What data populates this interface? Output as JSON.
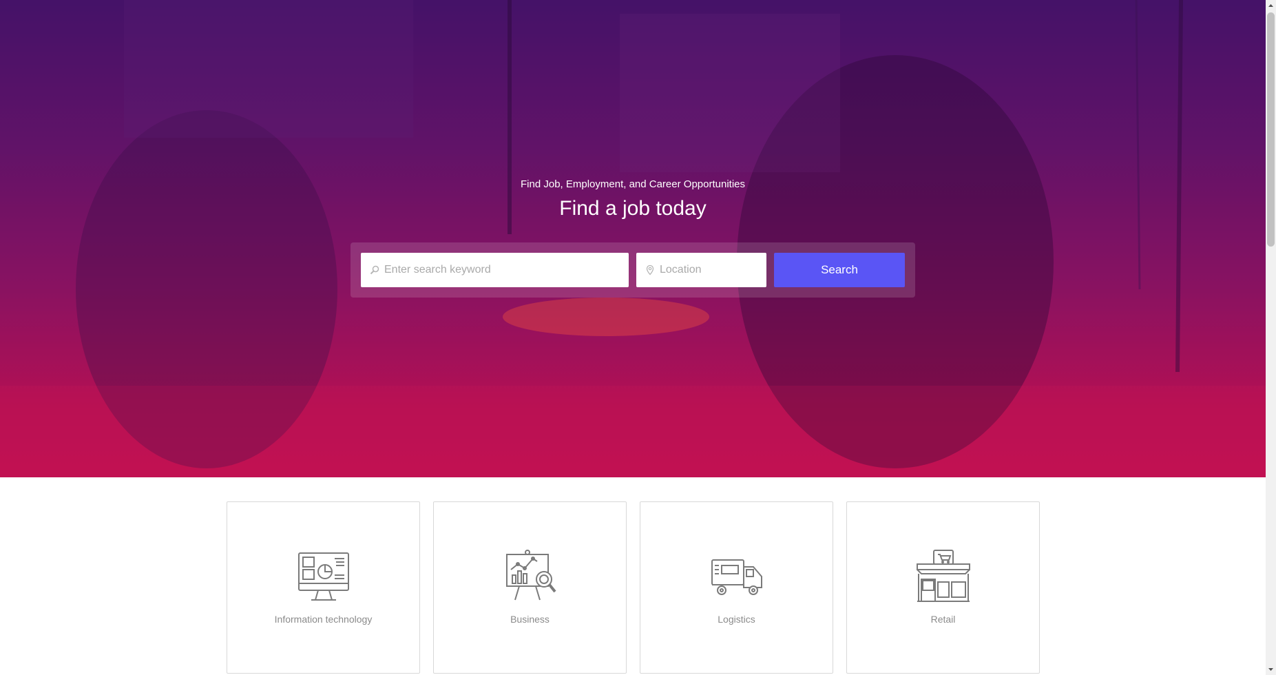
{
  "hero": {
    "subtitle": "Find Job, Employment, and Career Opportunities",
    "title": "Find a job today"
  },
  "search": {
    "keyword_placeholder": "Enter search keyword",
    "keyword_value": "",
    "location_placeholder": "Location",
    "location_value": "",
    "button_label": "Search",
    "button_color": "#5a55f5"
  },
  "categories": [
    {
      "label": "Information technology",
      "icon": "computer-monitor-icon"
    },
    {
      "label": "Business",
      "icon": "presentation-chart-icon"
    },
    {
      "label": "Logistics",
      "icon": "delivery-truck-icon"
    },
    {
      "label": "Retail",
      "icon": "storefront-icon"
    }
  ],
  "colors": {
    "hero_gradient_top": "#4a1470",
    "hero_gradient_bottom": "#d81256",
    "icon_gray": "#7a7a7a"
  }
}
